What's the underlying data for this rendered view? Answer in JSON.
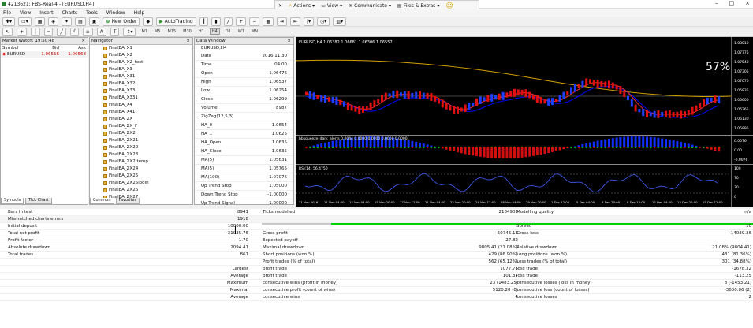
{
  "window": {
    "title": "4213621: FBS-Real-4 - [EURUSD,H4]",
    "minimize": "–",
    "maximize": "□",
    "close": "×"
  },
  "remote": {
    "items": [
      "Actions",
      "View",
      "Communicate",
      "Files & Extras"
    ]
  },
  "menu": [
    "File",
    "View",
    "Insert",
    "Charts",
    "Tools",
    "Window",
    "Help"
  ],
  "toolbar": {
    "new_order": "New Order",
    "autotrading": "AutoTrading"
  },
  "timeframes": [
    "M1",
    "M5",
    "M15",
    "M30",
    "H1",
    "H4",
    "D1",
    "W1",
    "MN"
  ],
  "market_watch": {
    "title": "Market Watch: 19:50:48",
    "col_symbol": "Symbol",
    "col_bid": "Bid",
    "col_ask": "Ask",
    "rows": [
      {
        "symbol": "EURUSD",
        "bid": "1.06556",
        "ask": "1.06568"
      }
    ],
    "tabs": [
      "Symbols",
      "Tick Chart"
    ]
  },
  "navigator": {
    "title": "Navigator",
    "items": [
      "FinalEA_X1",
      "FinalEA_X2",
      "FinalEA_X2_test",
      "FinalEA_X3",
      "FinalEA_X31",
      "FinalEA_X32",
      "FinalEA_X33",
      "FinalEA_X331",
      "FinalEA_X4",
      "FinalEA_X41",
      "FinalEA_ZX",
      "FinalEA_ZX_F",
      "FinalEA_ZX2",
      "FinalEA_ZX21",
      "FinalEA_ZX22",
      "FinalEA_ZX23",
      "FinalEA_ZX2 temp",
      "FinalEA_ZX24",
      "FinalEA_ZX25",
      "FinalEA_ZX25login",
      "FinalEA_ZX26",
      "FinalEA_ZX27"
    ],
    "tabs": [
      "Common",
      "Favorites"
    ]
  },
  "data_window": {
    "title": "Data Window",
    "symbol": "EURUSD,H4",
    "rows": [
      {
        "k": "Date",
        "v": "2016.11.30"
      },
      {
        "k": "Time",
        "v": "04:00"
      },
      {
        "k": "Open",
        "v": "1.06476"
      },
      {
        "k": "High",
        "v": "1.06537"
      },
      {
        "k": "Low",
        "v": "1.06254"
      },
      {
        "k": "Close",
        "v": "1.06299"
      },
      {
        "k": "Volume",
        "v": "8987"
      },
      {
        "k": "ZigZag(12,5,3)",
        "v": ""
      },
      {
        "k": "HA_0",
        "v": "1.0654"
      },
      {
        "k": "HA_1",
        "v": "1.0625"
      },
      {
        "k": "HA_Open",
        "v": "1.0635"
      },
      {
        "k": "HA_Close",
        "v": "1.0635"
      },
      {
        "k": "MA(5)",
        "v": "1.05631"
      },
      {
        "k": "MA(5)",
        "v": "1.05765"
      },
      {
        "k": "MA(100)",
        "v": "1.07076"
      },
      {
        "k": "Up Trend Stop",
        "v": "1.05000"
      },
      {
        "k": "Down Trend Stop",
        "v": "-1.00000"
      },
      {
        "k": "Up Trend Signal",
        "v": "-1.00000"
      },
      {
        "k": "Down Trend Signal",
        "v": "-1.00000"
      }
    ]
  },
  "chart": {
    "header": "EURUSD,H4  1.06382 1.06681 1.06306 1.06557",
    "percent": "57%",
    "osc_label": "bbsqueeze_dark_alerts 0.0044 0.0000 0.0000 0.0000 0.0000",
    "rsi_label": "RSI(14) 56.4750",
    "price_axis": [
      "1.08010",
      "1.07775",
      "1.07540",
      "1.07305",
      "1.07070",
      "1.06835",
      "1.06600",
      "1.06365",
      "1.06130",
      "1.05895"
    ],
    "osc_axis": [
      "0.0076",
      "0.00",
      "-0.0076"
    ],
    "rsi_axis": [
      "100",
      "70",
      "30",
      "0"
    ],
    "time_axis": [
      "31 Nov 2016",
      "11 Nov 04:00",
      "14 Nov 04:00",
      "15 Nov 20:00",
      "17 Nov 12:00",
      "21 Nov 04:00",
      "22 Nov 20:00",
      "24 Nov 12:00",
      "28 Nov 04:00",
      "29 Nov 20:00",
      "1 Dec 12:00",
      "5 Dec 04:00",
      "6 Dec 20:00",
      "8 Dec 12:00",
      "12 Dec 04:00",
      "13 Dec 20:00",
      "15 Dec 12:00"
    ],
    "colors": {
      "bull": "#1f3fff",
      "bear": "#e01010",
      "ma_slow": "#d4a000",
      "ma_fast": "#ff3030",
      "ma_mid": "#0000ff"
    }
  },
  "results": {
    "rows": [
      [
        "Bars in test",
        "8941",
        "Ticks modelled",
        "2184908",
        "Modelling quality",
        "n/a"
      ],
      [
        "Mismatched charts errors",
        "1918",
        "",
        "",
        "",
        ""
      ],
      [
        "Initial deposit",
        "10000.00",
        "",
        "",
        "Spread",
        "10"
      ],
      [
        "Total net profit",
        "-31035.76",
        "Gross profit",
        "50746.12",
        "Gross loss",
        "-14089.36"
      ],
      [
        "Profit factor",
        "1.70",
        "Expected payoff",
        "27.82",
        "",
        ""
      ],
      [
        "Absolute drawdown",
        "2094.41",
        "Maximal drawdown",
        "9805.41 (21.08%)",
        "Relative drawdown",
        "21.08% (9804.41)"
      ],
      [
        "Total trades",
        "861",
        "Short positions (won %)",
        "429 (86.90%)",
        "Long positions (won %)",
        "431 (81.36%)"
      ],
      [
        "",
        "",
        "Profit trades (% of total)",
        "562 (65.12%)",
        "Loss trades (% of total)",
        "301 (34.88%)"
      ],
      [
        "",
        "Largest",
        "profit trade",
        "1077.75",
        "loss trade",
        "-1678.32"
      ],
      [
        "",
        "Average",
        "profit trade",
        "101.37",
        "loss trade",
        "-113.25"
      ],
      [
        "",
        "Maximum",
        "consecutive wins (profit in money)",
        "23 (1483.25)",
        "consecutive losses (loss in money)",
        "8 (-1453.21)"
      ],
      [
        "",
        "Maximal",
        "consecutive profit (count of wins)",
        "5120.20 (8)",
        "consecutive loss (count of losses)",
        "-3600.86 (2)"
      ],
      [
        "",
        "Average",
        "consecutive wins",
        "4",
        "consecutive losses",
        "2"
      ]
    ]
  }
}
